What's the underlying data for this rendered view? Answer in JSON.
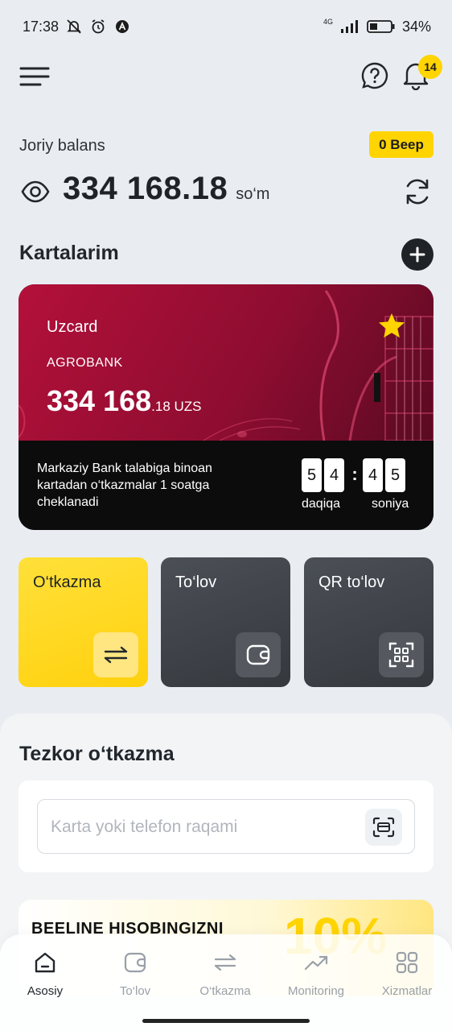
{
  "status_bar": {
    "time": "17:38",
    "network": "4G",
    "battery": "34%"
  },
  "header": {
    "notifications_count": "14"
  },
  "balance": {
    "label": "Joriy balans",
    "beep_badge": "0 Beep",
    "amount": "334 168.18",
    "currency": "so‘m"
  },
  "cards_section": {
    "title": "Kartalarim"
  },
  "card": {
    "type": "Uzcard",
    "bank": "AGROBANK",
    "balance_main": "334 168",
    "balance_fraction": ".18 UZS",
    "favorite_color": "#ffd400",
    "notice": "Markaziy Bank talabiga binoan kartadan  o‘tkazmalar 1 soatga cheklanadi",
    "timer": {
      "minutes": [
        "5",
        "4"
      ],
      "seconds": [
        "4",
        "5"
      ],
      "separator": ":",
      "minutes_label": "daqiqa",
      "seconds_label": "soniya"
    }
  },
  "actions": [
    {
      "label": "O‘tkazma",
      "icon": "transfer-arrows-icon"
    },
    {
      "label": "To‘lov",
      "icon": "wallet-icon"
    },
    {
      "label": "QR to‘lov",
      "icon": "qr-scan-icon"
    }
  ],
  "quick_transfer": {
    "title": "Tezkor o‘tkazma",
    "placeholder": "Karta yoki telefon raqami"
  },
  "promo": {
    "title": "BEELINE HISOBINGIZNI",
    "percent": "10%"
  },
  "tabbar": [
    {
      "label": "Asosiy",
      "icon": "home-icon",
      "active": true
    },
    {
      "label": "To‘lov",
      "icon": "wallet-icon",
      "active": false
    },
    {
      "label": "O‘tkazma",
      "icon": "transfer-arrows-icon",
      "active": false
    },
    {
      "label": "Monitoring",
      "icon": "trend-chart-icon",
      "active": false
    },
    {
      "label": "Xizmatlar",
      "icon": "grid-icon",
      "active": false
    }
  ],
  "colors": {
    "accent": "#ffd400",
    "card_red": "#b3103a",
    "dark_tile": "#3a3d42"
  }
}
